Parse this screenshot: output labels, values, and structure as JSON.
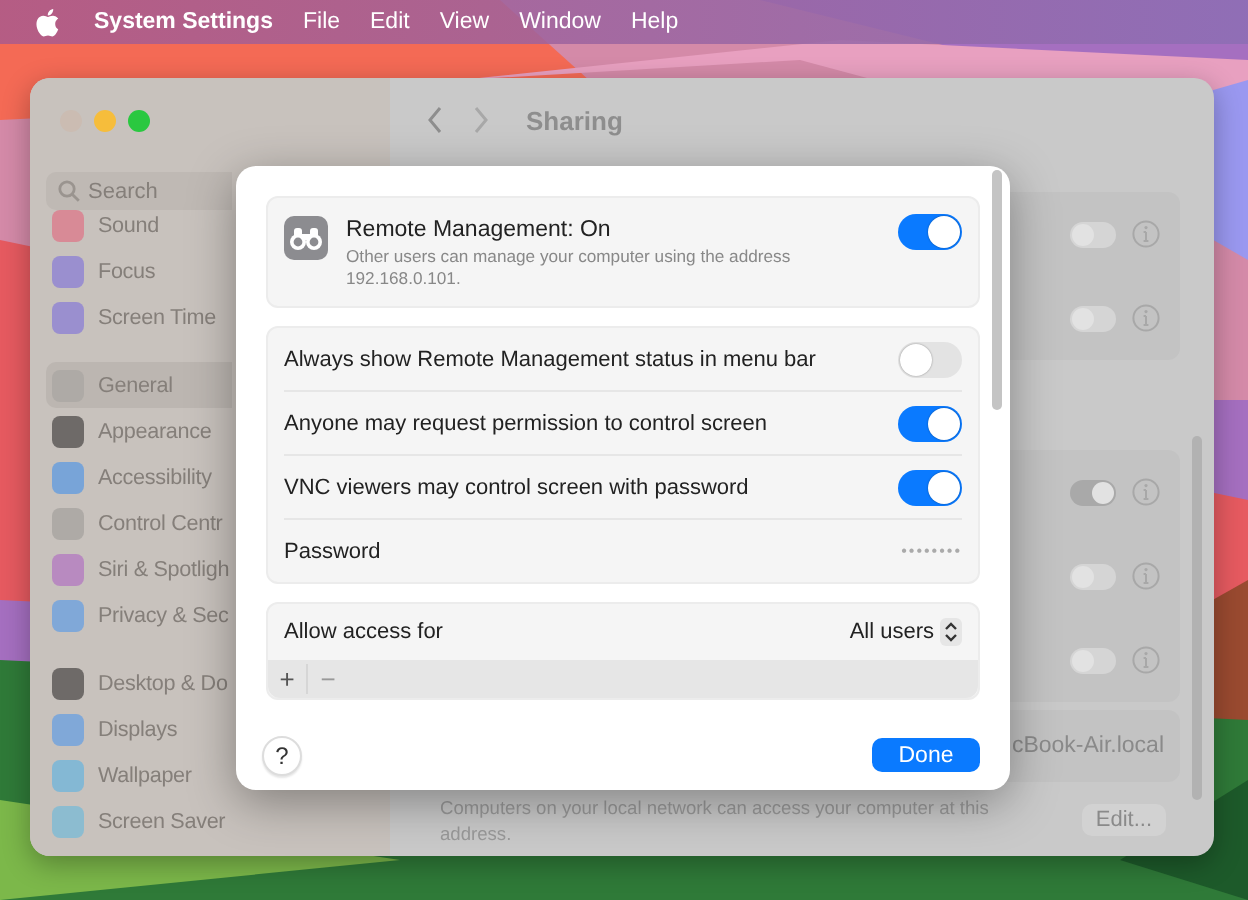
{
  "menu_bar": {
    "app_name": "System Settings",
    "items": [
      "File",
      "Edit",
      "View",
      "Window",
      "Help"
    ]
  },
  "window": {
    "title": "Sharing",
    "sidebar": {
      "search": {
        "placeholder": "Search"
      },
      "groups": [
        [
          {
            "label": "Sound",
            "color": "#d88a96",
            "selected": false
          },
          {
            "label": "Focus",
            "color": "#9a8fcf",
            "selected": false
          },
          {
            "label": "Screen Time",
            "color": "#9a8fcf",
            "selected": false
          }
        ],
        [
          {
            "label": "General",
            "color": "#aeaaa6",
            "selected": true
          },
          {
            "label": "Appearance",
            "color": "#6e6a68",
            "selected": false
          },
          {
            "label": "Accessibility",
            "color": "#78a4d8",
            "selected": false
          },
          {
            "label": "Control Centr",
            "color": "#aeaaa6",
            "selected": false
          },
          {
            "label": "Siri & Spotligh",
            "color": "#b88ac0",
            "selected": false
          },
          {
            "label": "Privacy & Sec",
            "color": "#80a8d8",
            "selected": false
          }
        ],
        [
          {
            "label": "Desktop & Do",
            "color": "#6e6a68",
            "selected": false
          },
          {
            "label": "Displays",
            "color": "#80a8d8",
            "selected": false
          },
          {
            "label": "Wallpaper",
            "color": "#84b8d4",
            "selected": false
          },
          {
            "label": "Screen Saver",
            "color": "#8cbcd0",
            "selected": false
          }
        ]
      ]
    },
    "services": [
      [
        {
          "on": false
        },
        {
          "on": false
        }
      ],
      [
        {
          "on": true
        },
        {
          "on": false
        },
        {
          "on": false
        }
      ]
    ],
    "hostname": "cBook-Air.local",
    "note": "Computers on your local network can access your computer at this address.",
    "edit_button": "Edit..."
  },
  "sheet": {
    "header": {
      "title": "Remote Management: On",
      "description": "Other users can manage your computer using the address 192.168.0.101.",
      "on": true
    },
    "options": [
      {
        "kind": "toggle",
        "label": "Always show Remote Management status in menu bar",
        "on": false
      },
      {
        "kind": "toggle",
        "label": "Anyone may request permission to control screen",
        "on": true
      },
      {
        "kind": "toggle",
        "label": "VNC viewers may control screen with password",
        "on": true
      },
      {
        "kind": "value",
        "label": "Password",
        "value": "••••••••"
      }
    ],
    "access": {
      "label": "Allow access for",
      "value": "All users"
    },
    "toolbar": [
      "+",
      "−"
    ],
    "help": "?",
    "done": "Done"
  }
}
